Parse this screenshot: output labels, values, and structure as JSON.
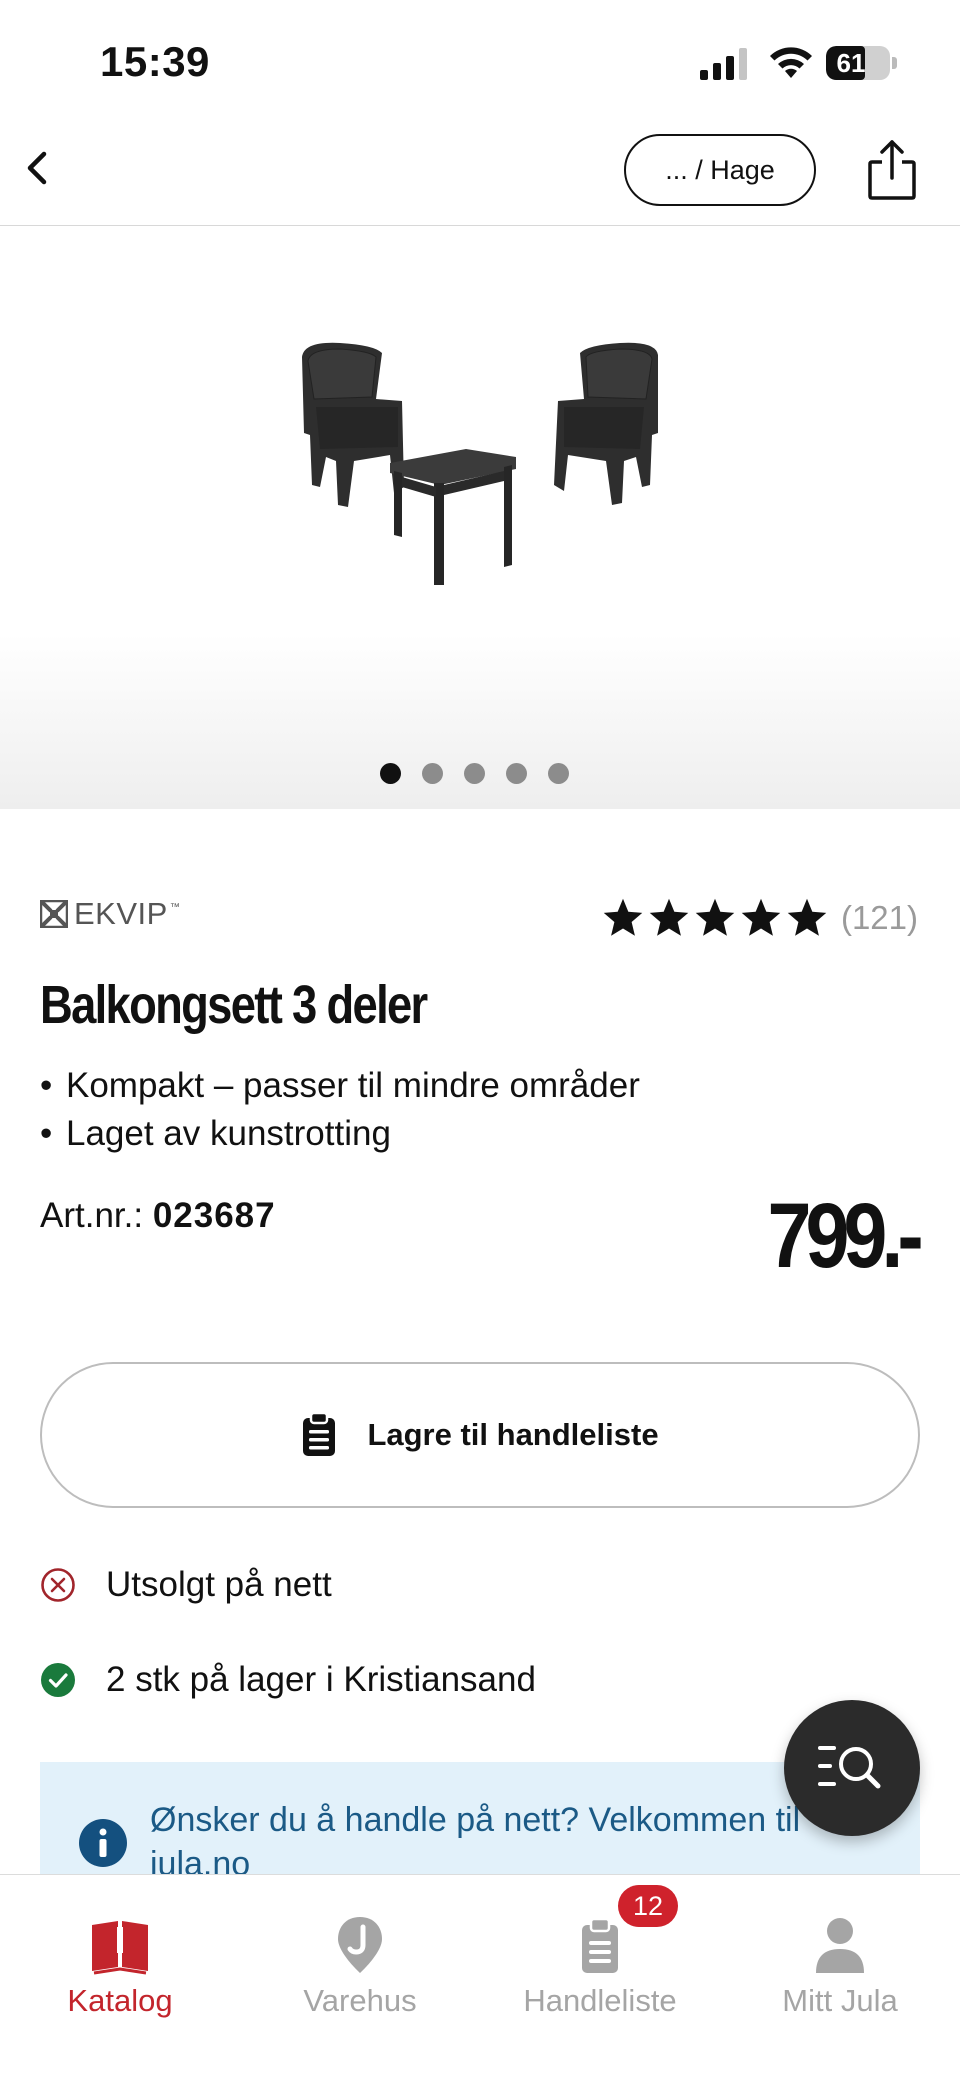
{
  "status_bar": {
    "time": "15:39",
    "battery_level": "61",
    "battery_percent": 61
  },
  "header": {
    "breadcrumb": "... / Hage",
    "back_icon": "chevron-left-icon",
    "share_icon": "share-icon"
  },
  "gallery": {
    "image_count": 5,
    "active_index": 0,
    "image_alt": "balcony-set-image"
  },
  "product": {
    "brand": "EKVIP",
    "brand_tm": "™",
    "rating": 5,
    "review_count": "(121)",
    "title": "Balkongsett 3 deler",
    "bullets": [
      "Kompakt – passer til mindre områder",
      "Laget av kunstrotting"
    ],
    "bullet_char": "•",
    "artnr_label": "Art.nr.: ",
    "artnr_value": "023687",
    "price": "799.-"
  },
  "actions": {
    "save_label": "Lagre til handleliste"
  },
  "availability": {
    "online": "Utsolgt på nett",
    "store": "2 stk på lager i Kristiansand"
  },
  "info_box": {
    "text": "Ønsker du å handle på nett? Velkommen til jula.no"
  },
  "colors": {
    "accent_red": "#c3252c",
    "badge_red": "#cf222c",
    "in_stock_green": "#1a7a3c",
    "info_blue": "#1b5a86",
    "info_bg": "#e2f1fa"
  },
  "tabs": [
    {
      "label": "Katalog",
      "icon": "catalog-book-icon",
      "active": true
    },
    {
      "label": "Varehus",
      "icon": "store-location-icon",
      "active": false
    },
    {
      "label": "Handleliste",
      "icon": "shopping-list-icon",
      "active": false,
      "badge": "12"
    },
    {
      "label": "Mitt Jula",
      "icon": "user-icon",
      "active": false
    }
  ]
}
